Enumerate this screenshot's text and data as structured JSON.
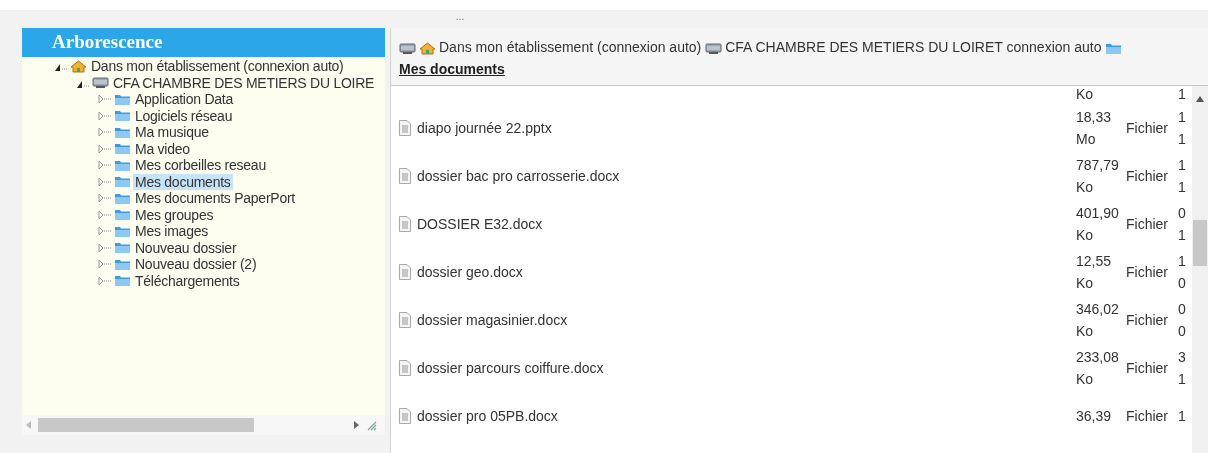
{
  "top_handle": "...",
  "tree": {
    "title": "Arborescence",
    "items": [
      {
        "kind": "home",
        "label": "Dans mon établissement (connexion auto)",
        "expanded": true,
        "selected": false,
        "children": [
          {
            "kind": "server",
            "label": "CFA CHAMBRE DES METIERS DU LOIRE",
            "expanded": true,
            "selected": false,
            "children": [
              {
                "kind": "folder",
                "label": "Application Data",
                "expanded": false,
                "selected": false
              },
              {
                "kind": "folder",
                "label": "Logiciels réseau",
                "expanded": false,
                "selected": false
              },
              {
                "kind": "folder",
                "label": "Ma musique",
                "expanded": false,
                "selected": false
              },
              {
                "kind": "folder",
                "label": "Ma video",
                "expanded": false,
                "selected": false
              },
              {
                "kind": "folder",
                "label": "Mes corbeilles reseau",
                "expanded": false,
                "selected": false
              },
              {
                "kind": "folder",
                "label": "Mes documents",
                "expanded": false,
                "selected": true
              },
              {
                "kind": "folder",
                "label": "Mes documents PaperPort",
                "expanded": false,
                "selected": false
              },
              {
                "kind": "folder",
                "label": "Mes groupes",
                "expanded": false,
                "selected": false
              },
              {
                "kind": "folder",
                "label": "Mes images",
                "expanded": false,
                "selected": false
              },
              {
                "kind": "folder",
                "label": "Nouveau dossier",
                "expanded": false,
                "selected": false
              },
              {
                "kind": "folder",
                "label": "Nouveau dossier (2)",
                "expanded": false,
                "selected": false
              },
              {
                "kind": "folder",
                "label": "Téléchargements",
                "expanded": false,
                "selected": false
              }
            ]
          }
        ]
      }
    ]
  },
  "breadcrumb": [
    {
      "kind": "server"
    },
    {
      "kind": "home",
      "label": "Dans mon établissement (connexion auto)"
    },
    {
      "kind": "server",
      "label": "CFA CHAMBRE DES METIERS DU LOIRET connexion auto"
    },
    {
      "kind": "folder",
      "label": "Mes documents",
      "current": true
    }
  ],
  "files": [
    {
      "size": [
        "Ko"
      ],
      "date": [
        "1"
      ]
    },
    {
      "name": "diapo journée 22.pptx",
      "size": [
        "18,33",
        "Mo"
      ],
      "type": "Fichier",
      "date": [
        "1",
        "1"
      ]
    },
    {
      "name": "dossier bac pro carrosserie.docx",
      "size": [
        "787,79",
        "Ko"
      ],
      "type": "Fichier",
      "date": [
        "1",
        "1"
      ]
    },
    {
      "name": "DOSSIER E32.docx",
      "size": [
        "401,90",
        "Ko"
      ],
      "type": "Fichier",
      "date": [
        "0",
        "1"
      ]
    },
    {
      "name": "dossier geo.docx",
      "size": [
        "12,55",
        "Ko"
      ],
      "type": "Fichier",
      "date": [
        "1",
        "0"
      ]
    },
    {
      "name": "dossier magasinier.docx",
      "size": [
        "346,02",
        "Ko"
      ],
      "type": "Fichier",
      "date": [
        "0",
        "0"
      ]
    },
    {
      "name": "dossier parcours coiffure.docx",
      "size": [
        "233,08",
        "Ko"
      ],
      "type": "Fichier",
      "date": [
        "3",
        "1"
      ]
    },
    {
      "name": "dossier pro 05PB.docx",
      "size": [
        "36,39"
      ],
      "type": "Fichier",
      "date": [
        "1"
      ]
    }
  ]
}
